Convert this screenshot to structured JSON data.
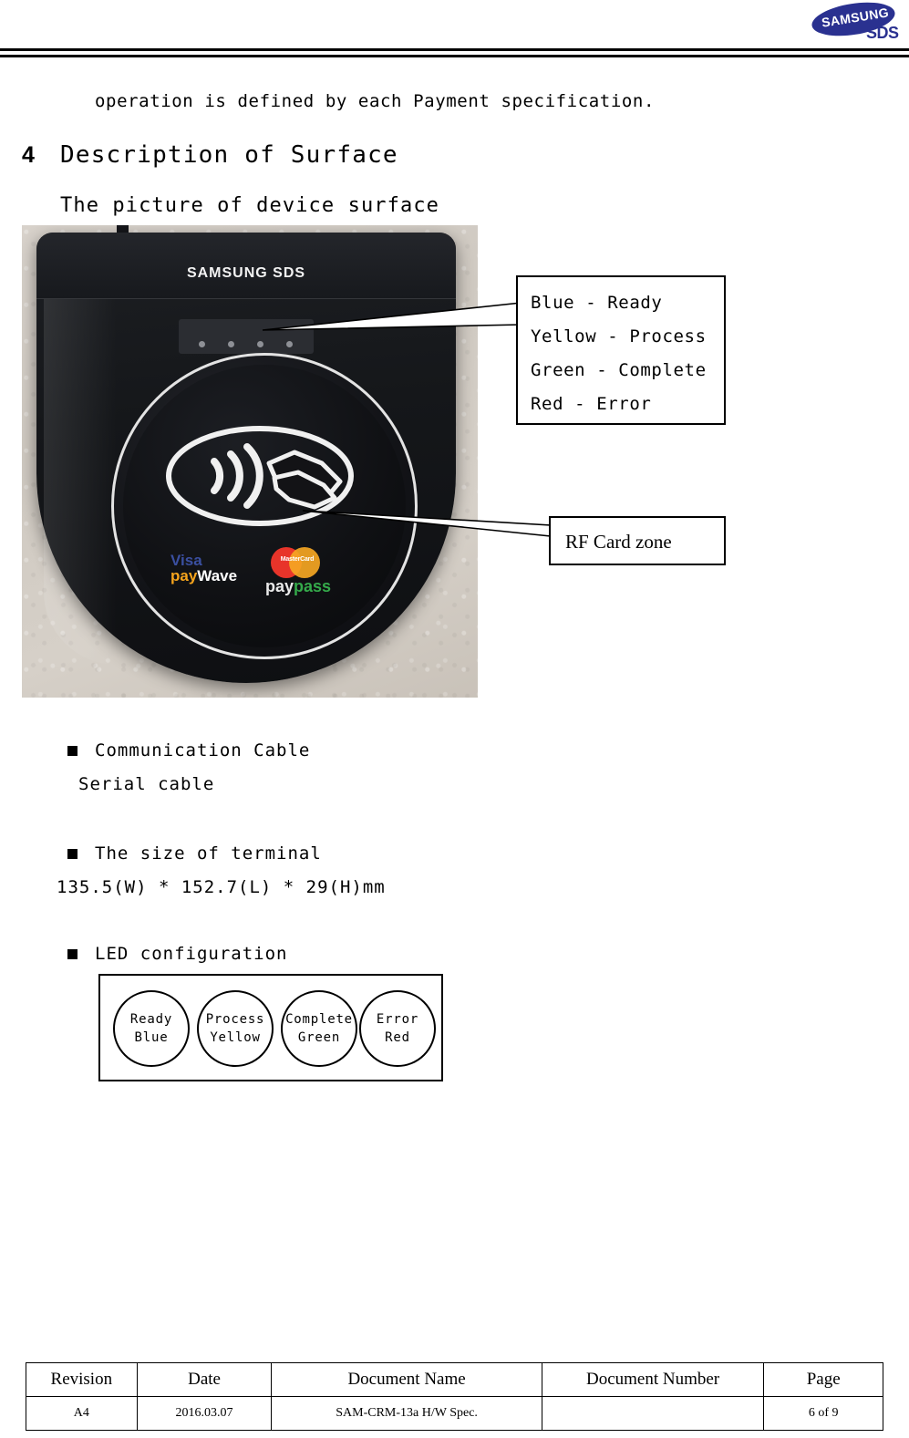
{
  "header": {
    "logo_brand": "SAMSUNG",
    "logo_sub": "SDS",
    "logo_color": "#2a3190"
  },
  "body": {
    "intro_line": "operation is defined by each Payment specification.",
    "section_number": "4",
    "section_title": "Description of Surface",
    "sub_title": "The picture of device surface"
  },
  "photo": {
    "device_brand": "SAMSUNG SDS",
    "card_logos": {
      "visa": "Visa",
      "visa_pay": "pay",
      "visa_wave": "Wave",
      "mastercard": "MasterCard",
      "paypass_pay": "pay",
      "paypass_pass": "pass"
    }
  },
  "callouts": {
    "led_box": [
      "Blue - Ready",
      "Yellow - Process",
      "Green - Complete",
      "Red - Error"
    ],
    "rf_box": "RF Card zone"
  },
  "bullets": [
    {
      "label": "Communication Cable",
      "sub": "Serial cable"
    },
    {
      "label": "The size of terminal",
      "sub": "135.5(W) * 152.7(L) * 29(H)mm"
    },
    {
      "label": "LED configuration",
      "sub": ""
    }
  ],
  "led_diagram": [
    {
      "state": "Ready",
      "color": "Blue"
    },
    {
      "state": "Process",
      "color": "Yellow"
    },
    {
      "state": "Complete",
      "color": "Green"
    },
    {
      "state": "Error",
      "color": "Red"
    }
  ],
  "footer": {
    "headers": [
      "Revision",
      "Date",
      "Document Name",
      "Document Number",
      "Page"
    ],
    "row": [
      "A4",
      "2016.03.07",
      "SAM-CRM-13a H/W Spec.",
      "",
      "6 of   9"
    ]
  }
}
